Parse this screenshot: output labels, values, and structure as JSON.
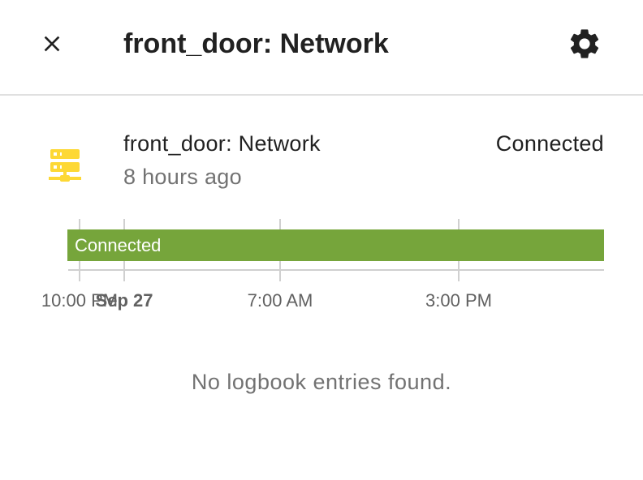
{
  "dialog": {
    "title": "front_door: Network"
  },
  "entity": {
    "name": "front_door: Network",
    "last_changed": "8 hours ago",
    "state": "Connected",
    "icon": "server-network-icon",
    "icon_color": "#fdd835"
  },
  "timeline": {
    "bar_label": "Connected",
    "bar_color": "#76a53b",
    "ticks": [
      {
        "label": "10:00 PM",
        "bold": false
      },
      {
        "label": "Sep 27",
        "bold": true
      },
      {
        "label": "7:00 AM",
        "bold": false
      },
      {
        "label": "3:00 PM",
        "bold": false
      }
    ]
  },
  "logbook": {
    "empty_message": "No logbook entries found."
  }
}
